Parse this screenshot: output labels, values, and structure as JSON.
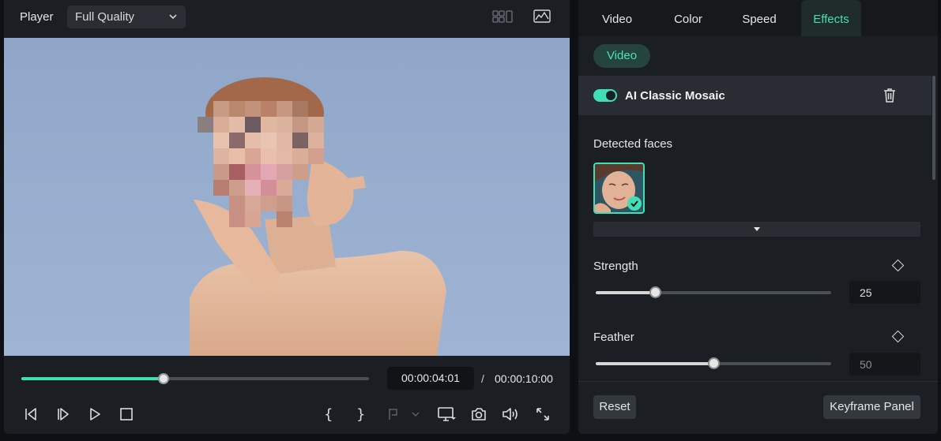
{
  "player": {
    "title": "Player",
    "quality": "Full Quality",
    "time_current": "00:00:04:01",
    "time_separator": "/",
    "time_total": "00:00:10:00",
    "progress": 0.41,
    "header_icons": [
      "compare-view-icon",
      "image-scope-icon"
    ],
    "controls": [
      "previous-frame-icon",
      "next-frame-icon",
      "play-icon",
      "stop-icon",
      "mark-in-icon",
      "mark-out-icon",
      "snapshot-marker-icon",
      "display-icon",
      "camera-icon",
      "volume-icon",
      "fullscreen-icon"
    ]
  },
  "panel": {
    "tabs": [
      {
        "label": "Video",
        "active": false
      },
      {
        "label": "Color",
        "active": false
      },
      {
        "label": "Speed",
        "active": false
      },
      {
        "label": "Effects",
        "active": true
      }
    ],
    "subtab": "Video",
    "effect": {
      "name": "AI Classic Mosaic",
      "enabled": true
    },
    "detected_faces_label": "Detected faces",
    "strength": {
      "label": "Strength",
      "value": "25",
      "level": 0.25
    },
    "feather": {
      "label": "Feather",
      "value": "50",
      "level": 0.5
    },
    "reset_label": "Reset",
    "keyframe_label": "Keyframe Panel"
  },
  "colors": {
    "accent": "#3fe0b5",
    "panel_bg": "#1b1e23",
    "app_bg": "#0e1013"
  }
}
